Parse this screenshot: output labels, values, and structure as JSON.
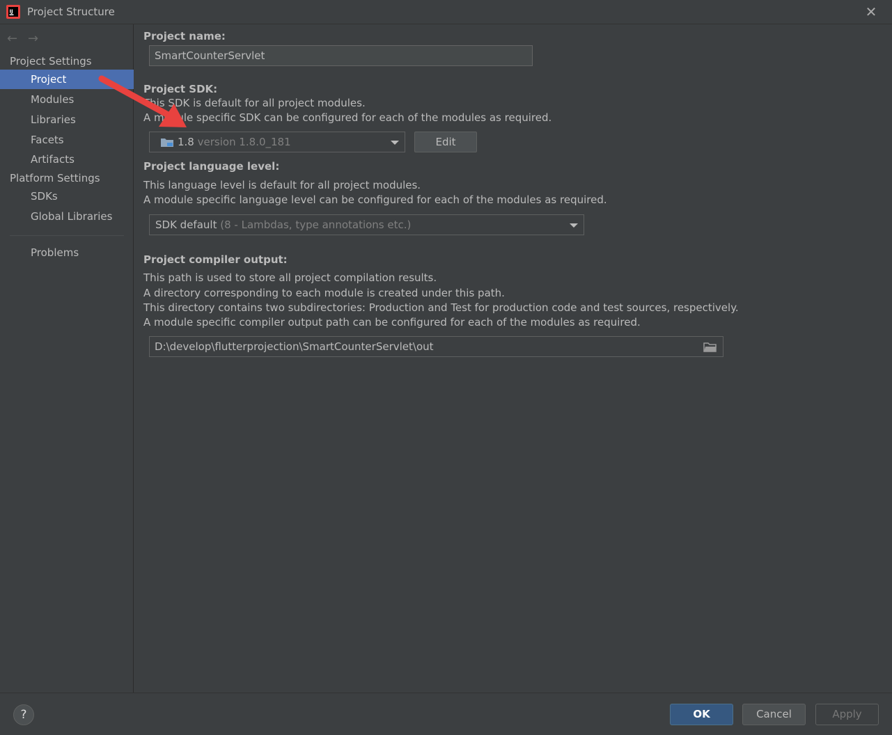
{
  "window": {
    "title": "Project Structure"
  },
  "sidebar": {
    "project_settings_header": "Project Settings",
    "project_settings_items": [
      {
        "label": "Project",
        "selected": true
      },
      {
        "label": "Modules"
      },
      {
        "label": "Libraries"
      },
      {
        "label": "Facets"
      },
      {
        "label": "Artifacts"
      }
    ],
    "platform_settings_header": "Platform Settings",
    "platform_settings_items": [
      {
        "label": "SDKs"
      },
      {
        "label": "Global Libraries"
      }
    ],
    "problems_label": "Problems"
  },
  "main": {
    "project_name": {
      "label": "Project name:",
      "value": "SmartCounterServlet"
    },
    "project_sdk": {
      "label": "Project SDK:",
      "desc_line1": "This SDK is default for all project modules.",
      "desc_line2": "A module specific SDK can be configured for each of the modules as required.",
      "selected_name": "1.8",
      "selected_detail": "version 1.8.0_181",
      "edit_button": "Edit"
    },
    "language_level": {
      "label": "Project language level:",
      "desc_line1": "This language level is default for all project modules.",
      "desc_line2": "A module specific language level can be configured for each of the modules as required.",
      "selected_name": "SDK default",
      "selected_detail": "(8 - Lambdas, type annotations etc.)"
    },
    "compiler_output": {
      "label": "Project compiler output:",
      "desc_line1": "This path is used to store all project compilation results.",
      "desc_line2": "A directory corresponding to each module is created under this path.",
      "desc_line3": "This directory contains two subdirectories: Production and Test for production code and test sources, respectively.",
      "desc_line4": "A module specific compiler output path can be configured for each of the modules as required.",
      "path": "D:\\develop\\flutterprojection\\SmartCounterServlet\\out"
    }
  },
  "footer": {
    "help_label": "?",
    "ok_label": "OK",
    "cancel_label": "Cancel",
    "apply_label": "Apply"
  },
  "colors": {
    "background": "#3c3f41",
    "selection": "#4b6eaf",
    "ok_button": "#365880",
    "annotation_arrow": "#e8423f"
  }
}
